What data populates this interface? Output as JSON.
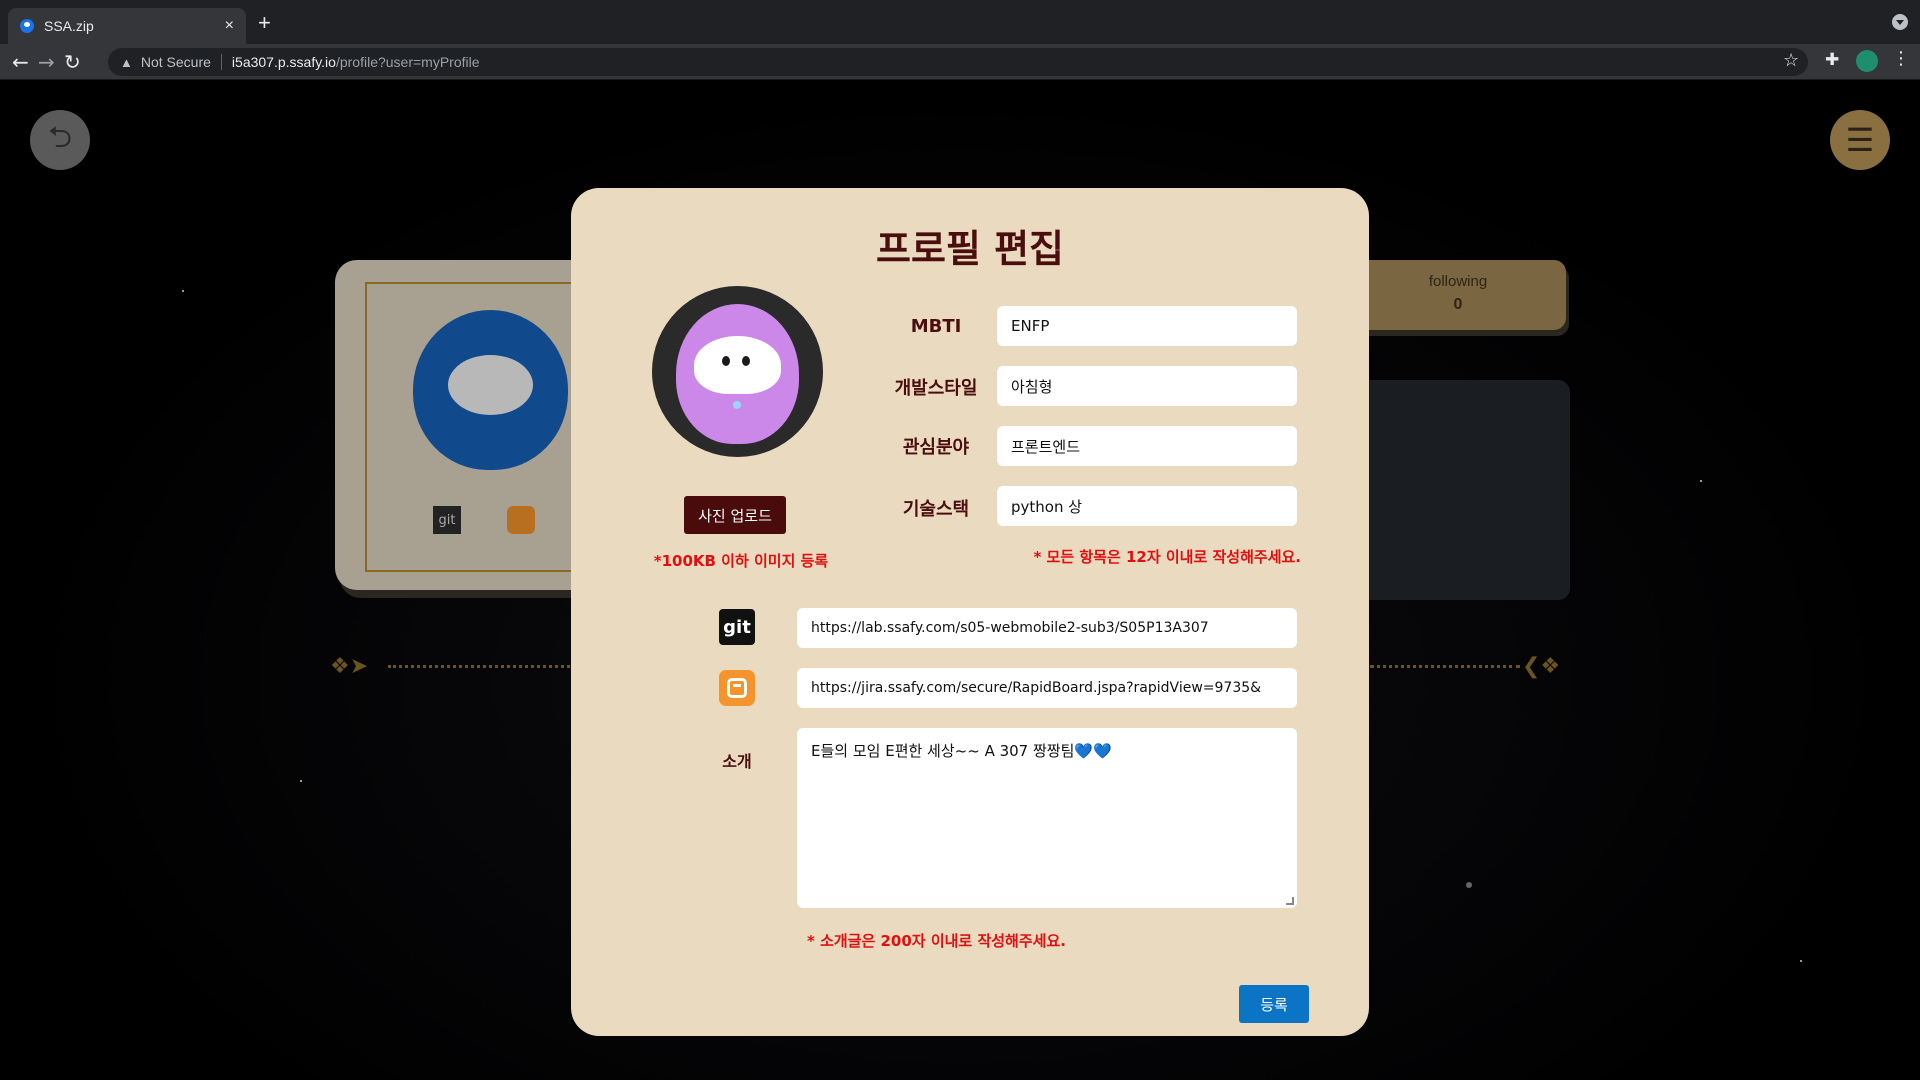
{
  "browser": {
    "tab_title": "SSA.zip",
    "tab_close": "×",
    "new_tab": "+",
    "security_label": "Not Secure",
    "url_host": "i5a307.p.ssafy.io",
    "url_path": "/profile?user=myProfile"
  },
  "background": {
    "following_label": "following",
    "following_count": "0",
    "git_label": "git"
  },
  "modal": {
    "title": "프로필 편집",
    "upload_button": "사진 업로드",
    "upload_note": "*100KB 이하 이미지 등록",
    "fields": [
      {
        "label": "MBTI",
        "value": "ENFP"
      },
      {
        "label": "개발스타일",
        "value": "아침형"
      },
      {
        "label": "관심분야",
        "value": "프론트엔드"
      },
      {
        "label": "기술스택",
        "value": "python 상"
      }
    ],
    "fields_note": "* 모든 항목은 12자 이내로 작성해주세요.",
    "git_icon_label": "git",
    "git_url": "https://lab.ssafy.com/s05-webmobile2-sub3/S05P13A307",
    "blog_url": "https://jira.ssafy.com/secure/RapidBoard.jspa?rapidView=9735&",
    "intro_label": "소개",
    "intro_text": "E들의 모임 E편한 세상~~ A 307 짱짱팀💙💙",
    "intro_note": "* 소개글은 200자 이내로 작성해주세요.",
    "submit_button": "등록"
  },
  "colors": {
    "modal_bg": "#e9dac0",
    "title_color": "#4a0e0e",
    "warning_red": "#e01010",
    "submit_blue": "#0b74c4"
  },
  "icons": [
    "back-arrow-icon",
    "forward-arrow-icon",
    "reload-icon",
    "warning-icon",
    "bookmark-star-icon",
    "extensions-icon",
    "profile-avatar-icon",
    "kebab-menu-icon",
    "exit-icon",
    "hamburger-menu-icon",
    "git-icon",
    "blogger-icon"
  ]
}
